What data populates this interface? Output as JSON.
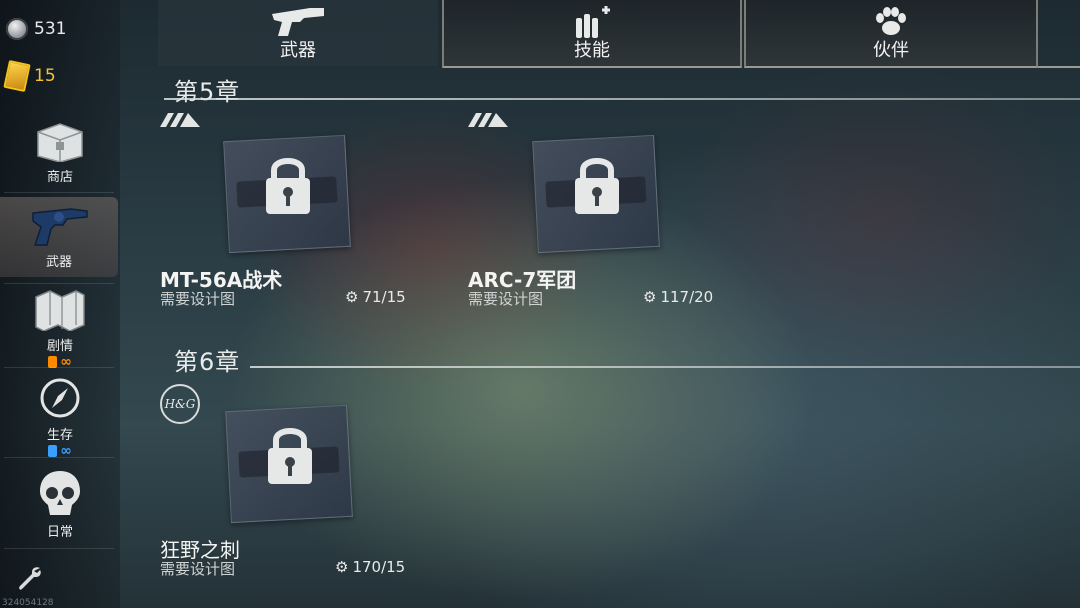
{
  "currencies": {
    "silver": "531",
    "gold_tickets": "15"
  },
  "sidebar": {
    "items": [
      {
        "label": "商店",
        "icon": "chest-icon"
      },
      {
        "label": "武器",
        "icon": "revolver-icon",
        "active": true
      },
      {
        "label": "剧情",
        "icon": "map-icon",
        "badge": "∞",
        "badge_color": "#ff8a00"
      },
      {
        "label": "生存",
        "icon": "compass-icon",
        "badge": "∞",
        "badge_color": "#3aa0ff"
      },
      {
        "label": "日常",
        "icon": "skull-icon"
      }
    ],
    "version": "324054128"
  },
  "tabs": [
    {
      "label": "武器",
      "icon": "pistol-icon",
      "active": true
    },
    {
      "label": "技能",
      "icon": "ammo-plus-icon",
      "active": false
    },
    {
      "label": "伙伴",
      "icon": "paw-icon",
      "active": false
    }
  ],
  "chapters": [
    {
      "title": "第5章",
      "weapons": [
        {
          "name": "MT-56A战术",
          "requirement": "需要设计图",
          "count": "71/15"
        },
        {
          "name": "ARC-7军团",
          "requirement": "需要设计图",
          "count": "117/20"
        }
      ]
    },
    {
      "title": "第6章",
      "brand": "H&G",
      "weapons": [
        {
          "name": "狂野之刺",
          "requirement": "需要设计图",
          "count": "170/15"
        }
      ]
    }
  ]
}
